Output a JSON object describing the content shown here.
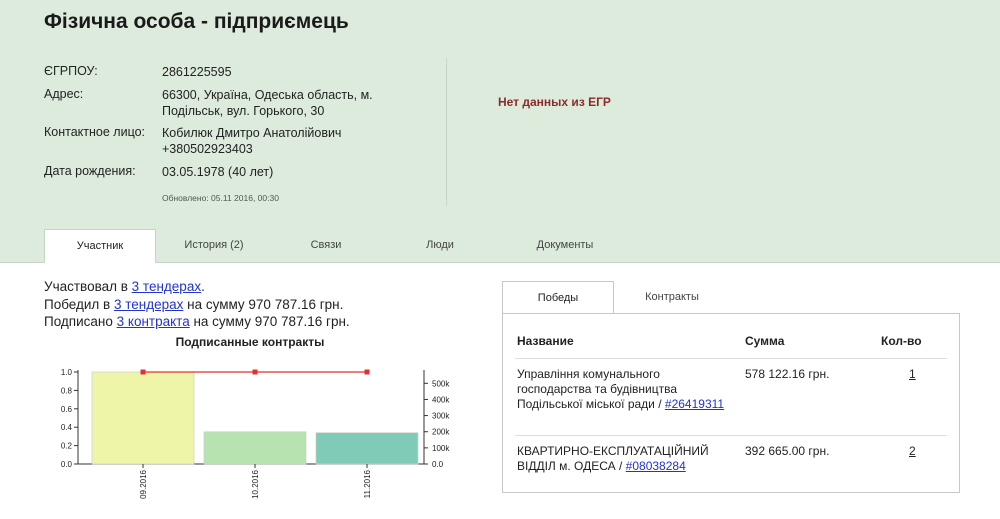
{
  "header": {
    "title": "Фізична особа - підприємець",
    "fields": [
      {
        "label": "ЄГРПОУ:",
        "value": "2861225595"
      },
      {
        "label": "Адрес:",
        "value": "66300, Україна, Одеська область, м. Подільськ, вул. Горького, 30"
      },
      {
        "label": "Контактное лицо:",
        "value": "Кобилюк Дмитро Анатолійович",
        "extra": "+380502923403"
      },
      {
        "label": "Дата рождения:",
        "value": "03.05.1978 (40 лет)"
      }
    ],
    "updated": "Обновлено: 05.11 2016, 00:30",
    "no_data": "Нет данных из ЕГР"
  },
  "tabs": [
    {
      "label": "Участник",
      "active": true
    },
    {
      "label": "История (2)",
      "active": false
    },
    {
      "label": "Связи",
      "active": false
    },
    {
      "label": "Люди",
      "active": false
    },
    {
      "label": "Документы",
      "active": false
    }
  ],
  "participation": {
    "line1_prefix": "Участвовал в ",
    "line1_link": "3 тендерах",
    "line1_suffix": ".",
    "line2_prefix": "Победил в ",
    "line2_link": "3 тендерах",
    "line2_suffix": " на сумму 970 787.16 грн.",
    "line3_prefix": "Подписано ",
    "line3_link": "3 контракта",
    "line3_suffix": " на сумму 970 787.16 грн."
  },
  "chart_data": {
    "type": "bar",
    "title": "Подписанные контракты",
    "categories": [
      "09.2016",
      "10.2016",
      "11.2016"
    ],
    "series": [
      {
        "values": [
          1.0,
          0.35,
          0.34
        ],
        "axis": "left",
        "colors": [
          "#eef5a8",
          "#b6e3b0",
          "#7fcbb8"
        ]
      },
      {
        "values": [
          570000,
          570000,
          570000
        ],
        "axis": "right",
        "kind": "line",
        "color": "#e03030"
      }
    ],
    "left_ticks": [
      "1.0",
      "0.8",
      "0.6",
      "0.4",
      "0.2",
      "0.0"
    ],
    "right_ticks": [
      "500k",
      "400k",
      "300k",
      "200k",
      "100k",
      "0.0"
    ],
    "ylim_left": [
      0,
      1.0
    ],
    "ylim_right": [
      0,
      570000
    ]
  },
  "panel": {
    "tabs": [
      {
        "label": "Победы",
        "active": true
      },
      {
        "label": "Контракты",
        "active": false
      }
    ],
    "headers": {
      "name": "Название",
      "sum": "Сумма",
      "count": "Кол-во"
    },
    "rows": [
      {
        "name": "Управління комунального господарства та будівництва Подільської міської ради /",
        "code": "#26419311",
        "sum": "578 122.16 грн.",
        "count": "1"
      },
      {
        "name": "КВАРТИРНО-ЕКСПЛУАТАЦІЙНИЙ ВІДДІЛ м. ОДЕСА /",
        "code": "#08038284",
        "sum": "392 665.00 грн.",
        "count": "2"
      }
    ]
  }
}
